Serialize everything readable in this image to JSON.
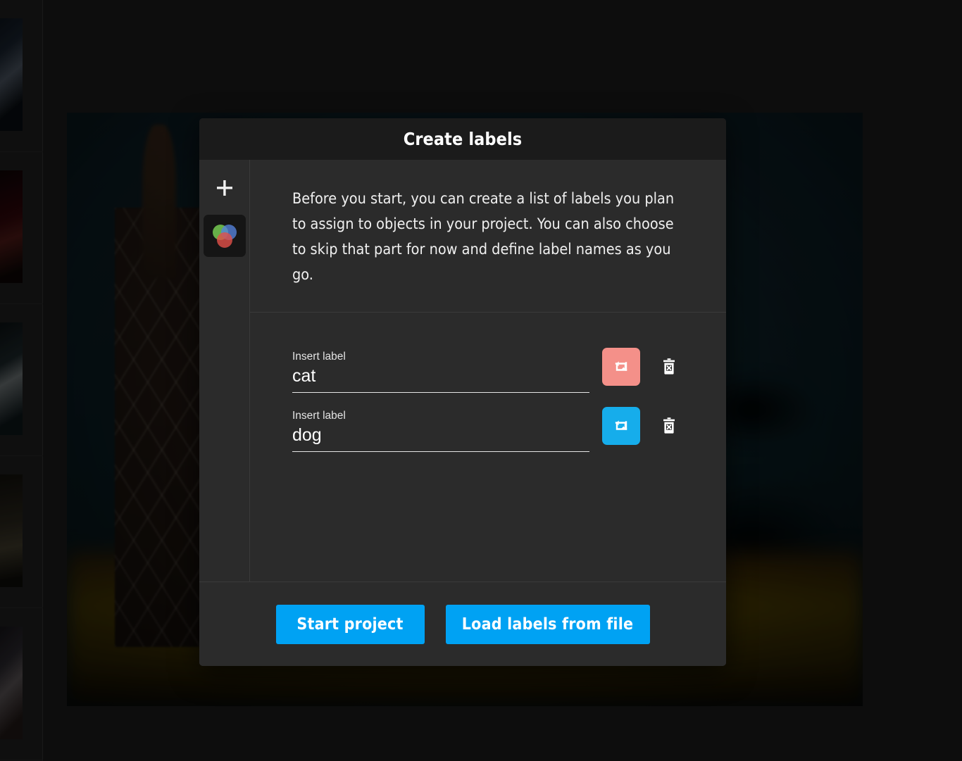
{
  "modal": {
    "title": "Create labels",
    "intro": "Before you start, you can create a list of labels you plan to assign to objects in your project. You can also choose to skip that part for now and define label names as you go.",
    "rail": {
      "add_icon": "plus-icon",
      "add_tooltip": "+",
      "palette_icon": "color-palette-icon"
    },
    "rows": [
      {
        "field_label": "Insert label",
        "value": "cat",
        "placeholder": "Insert label",
        "color": "#f49089",
        "swatch_icon": "shuffle-color-icon",
        "delete_icon": "delete-icon"
      },
      {
        "field_label": "Insert label",
        "value": "dog",
        "placeholder": "Insert label",
        "color": "#16adeb",
        "swatch_icon": "shuffle-color-icon",
        "delete_icon": "delete-icon"
      }
    ],
    "footer": {
      "start_label": "Start project",
      "load_label": "Load labels from file"
    }
  },
  "theme": {
    "accent_blue": "#00a2f3",
    "modal_bg": "#2b2b2b",
    "header_bg": "#1b1b1b",
    "divider": "#3a3a3a",
    "text": "#f0f0f0"
  },
  "background": {
    "filmstrip": [
      {
        "name": "thumbnail-1"
      },
      {
        "name": "thumbnail-2"
      },
      {
        "name": "thumbnail-3"
      },
      {
        "name": "thumbnail-4"
      },
      {
        "name": "thumbnail-5"
      }
    ]
  }
}
